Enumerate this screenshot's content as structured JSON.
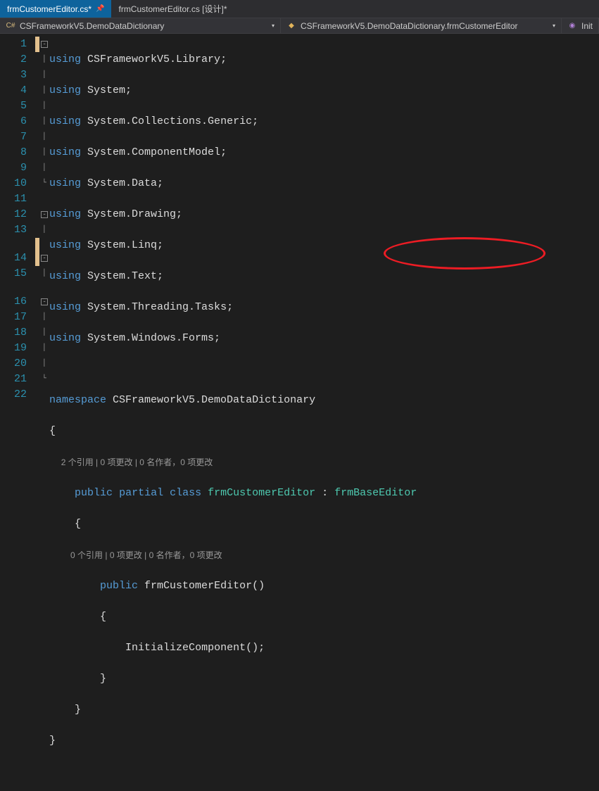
{
  "tabs": {
    "active": "frmCustomerEditor.cs*",
    "inactive": "frmCustomerEditor.cs [设计]*"
  },
  "nav": {
    "namespace": "CSFrameworkV5.DemoDataDictionary",
    "class": "CSFrameworkV5.DemoDataDictionary.frmCustomerEditor",
    "member": "Init"
  },
  "lines": [
    "1",
    "2",
    "3",
    "4",
    "5",
    "6",
    "7",
    "8",
    "9",
    "10",
    "11",
    "12",
    "13",
    "14",
    "15",
    "16",
    "17",
    "18",
    "19",
    "20",
    "21",
    "22"
  ],
  "codelens": {
    "class": "2 个引用 | 0 项更改 | 0 名作者，0 项更改",
    "ctor": "0 个引用 | 0 项更改 | 0 名作者，0 项更改"
  },
  "code": {
    "l1": {
      "kw": "using",
      "txt": " CSFrameworkV5.Library;"
    },
    "l2": {
      "kw": "using",
      "txt": " System;"
    },
    "l3": {
      "kw": "using",
      "txt": " System.Collections.Generic;"
    },
    "l4": {
      "kw": "using",
      "txt": " System.ComponentModel;"
    },
    "l5": {
      "kw": "using",
      "txt": " System.Data;"
    },
    "l6": {
      "kw": "using",
      "txt": " System.Drawing;"
    },
    "l7": {
      "kw": "using",
      "txt": " System.Linq;"
    },
    "l8": {
      "kw": "using",
      "txt": " System.Text;"
    },
    "l9": {
      "kw": "using",
      "txt": " System.Threading.Tasks;"
    },
    "l10": {
      "kw": "using",
      "txt": " System.Windows.Forms;"
    },
    "l12": {
      "kw": "namespace",
      "txt": " CSFrameworkV5.DemoDataDictionary"
    },
    "l13": "{",
    "l14": {
      "k1": "public",
      "k2": "partial",
      "k3": "class",
      "t1": "frmCustomerEditor",
      "colon": " : ",
      "t2": "frmBaseEditor"
    },
    "l15": "{",
    "l16": {
      "k1": "public",
      "ctor": " frmCustomerEditor()"
    },
    "l17": "{",
    "l18": "InitializeComponent();",
    "l19": "}",
    "l20": "}",
    "l21": "}"
  }
}
